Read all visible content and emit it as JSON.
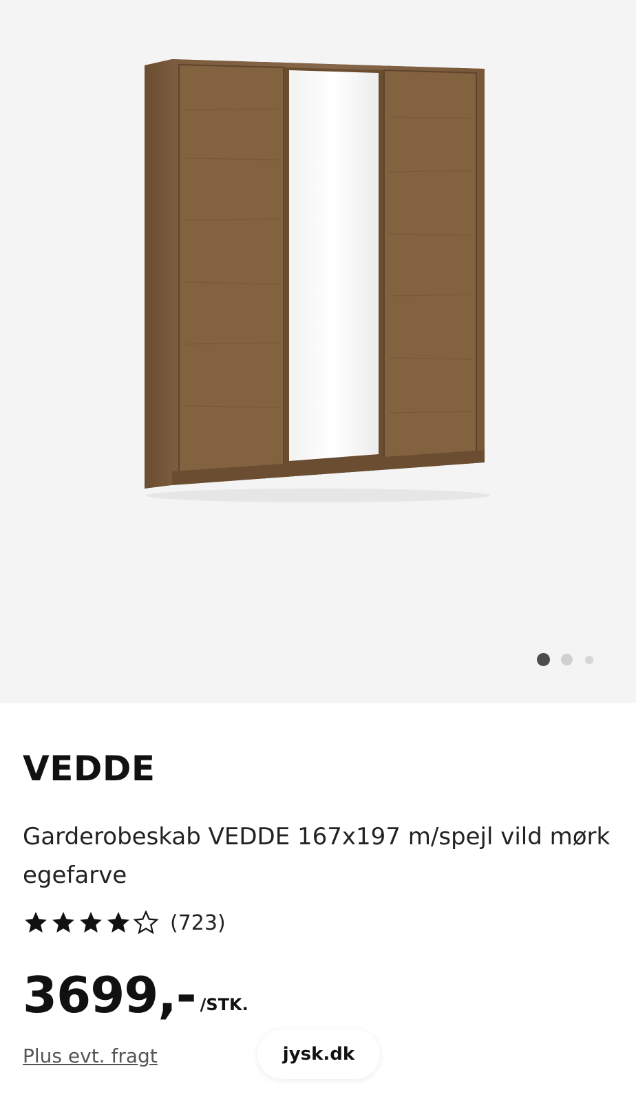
{
  "gallery": {
    "image_alt": "wardrobe-with-mirror",
    "dots_total": 3,
    "active_index": 0
  },
  "product": {
    "brand": "VEDDE",
    "title": "Garderobeskab VEDDE 167x197 m/spejl vild mørk egefarve",
    "rating_value": 4,
    "rating_max": 5,
    "rating_count": "(723)",
    "price": "3699,-",
    "price_unit": "/STK.",
    "shipping_note": "Plus evt. fragt"
  },
  "footer": {
    "site": "jysk.dk"
  },
  "colors": {
    "gallery_bg": "#f4f4f4",
    "wood": "#7a5a3a",
    "text": "#111111",
    "dot_active": "#4d4d4d",
    "dot_inactive": "#d0d0d0"
  }
}
